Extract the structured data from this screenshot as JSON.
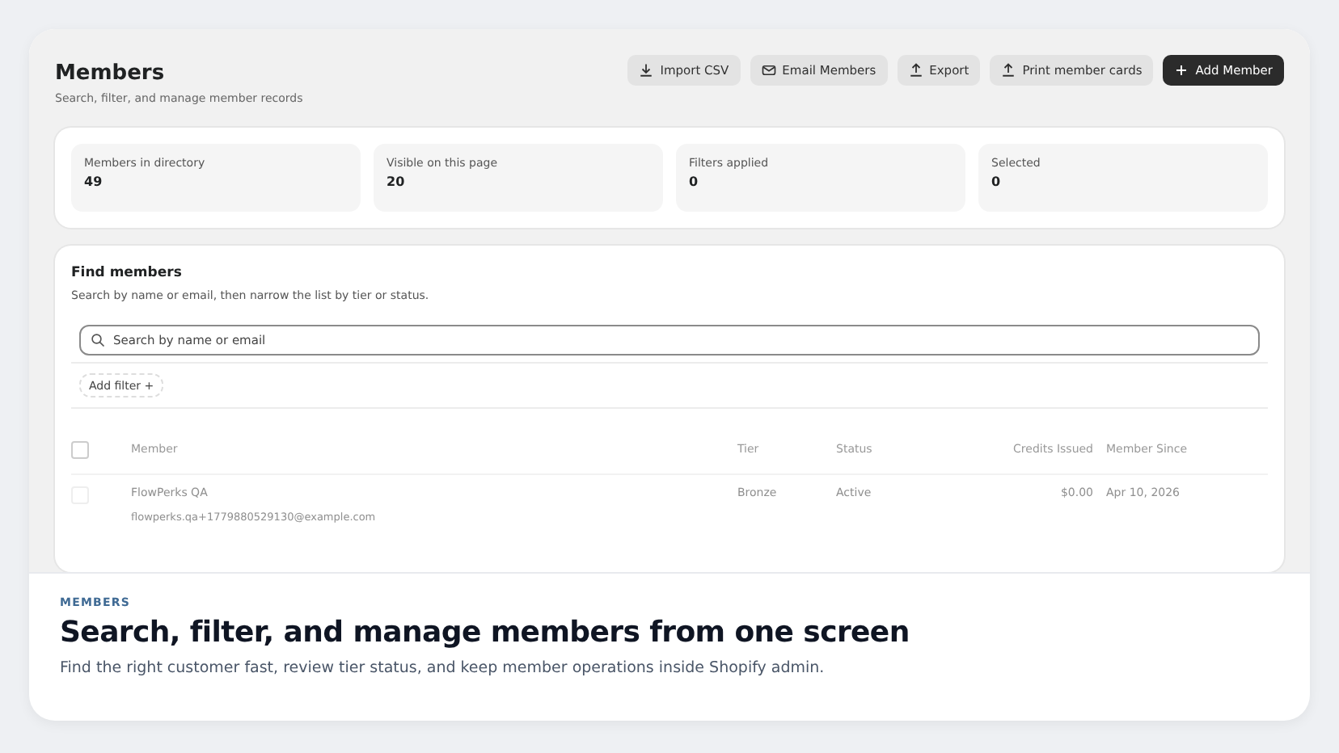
{
  "page": {
    "title": "Members",
    "subtitle": "Search, filter, and manage member records"
  },
  "actions": [
    {
      "label": "Import CSV",
      "kind": "import",
      "primary": false
    },
    {
      "label": "Email Members",
      "kind": "email",
      "primary": false
    },
    {
      "label": "Export",
      "kind": "export",
      "primary": false
    },
    {
      "label": "Print member cards",
      "kind": "export",
      "primary": false
    },
    {
      "label": "Add Member",
      "kind": "add",
      "primary": true
    }
  ],
  "stats": [
    {
      "label": "Members in directory",
      "value": "49"
    },
    {
      "label": "Visible on this page",
      "value": "20"
    },
    {
      "label": "Filters applied",
      "value": "0"
    },
    {
      "label": "Selected",
      "value": "0"
    }
  ],
  "find": {
    "title": "Find members",
    "description": "Search by name or email, then narrow the list by tier or status.",
    "search": {
      "placeholder": "Search by name or email"
    },
    "add_filter": "Add filter +"
  },
  "table": {
    "select_all": {
      "checked": false
    },
    "columns": [
      "Member",
      "Tier",
      "Status",
      "Credits Issued",
      "Member Since"
    ],
    "rows": [
      {
        "checked": false,
        "name": "FlowPerks QA",
        "email": "flowperks.qa+1779880529130@example.com",
        "tier": "Bronze",
        "status": "Active",
        "credits": "$0.00",
        "since": "Apr 10, 2026"
      }
    ]
  },
  "caption": {
    "eyebrow": "MEMBERS",
    "headline": "Search, filter, and manage members from one screen",
    "text": "Find the right customer fast, review tier status, and keep member operations inside Shopify admin."
  }
}
